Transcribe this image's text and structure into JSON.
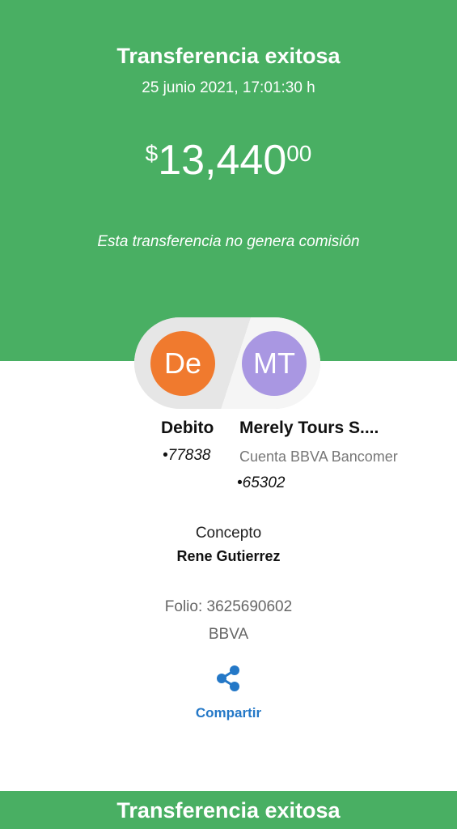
{
  "header": {
    "title": "Transferencia exitosa",
    "datetime": "25 junio 2021, 17:01:30 h",
    "amount_currency": "$",
    "amount_main": "13,440",
    "amount_cents": "00",
    "commission_note": "Esta transferencia no genera comisión"
  },
  "colors": {
    "brand_green": "#49af63",
    "origin_avatar": "#f07a2e",
    "dest_avatar": "#a997e2",
    "link_blue": "#2478c7"
  },
  "origin": {
    "initials": "De",
    "name": "Debito",
    "account": "•77838"
  },
  "destination": {
    "initials": "MT",
    "name": "Merely Tours S....",
    "bank_name": "Cuenta BBVA Bancomer",
    "account": "•65302"
  },
  "details": {
    "concept_label": "Concepto",
    "concept_value": "Rene Gutierrez",
    "folio": "Folio: 3625690602",
    "bank": "BBVA"
  },
  "actions": {
    "share_icon": "share-icon",
    "share_label": "Compartir"
  },
  "footer": {
    "title": "Transferencia exitosa"
  }
}
